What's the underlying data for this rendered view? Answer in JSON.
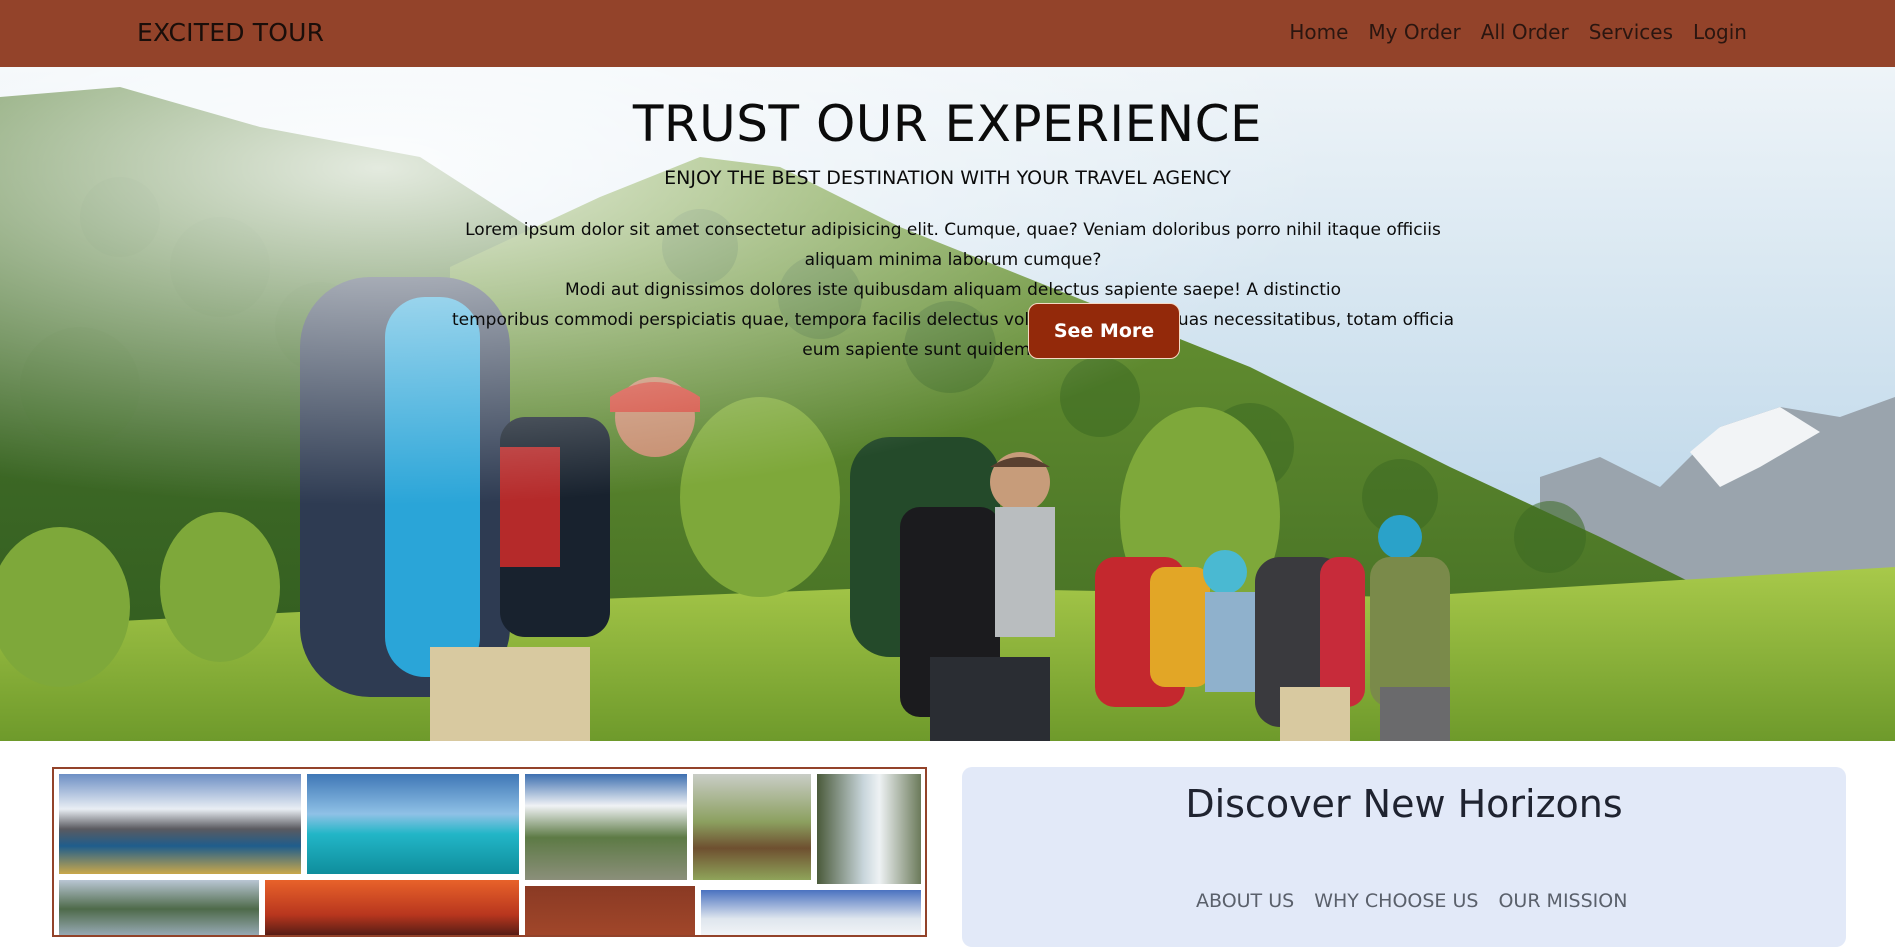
{
  "navbar": {
    "brand": "EXCITED TOUR",
    "links": [
      "Home",
      "My Order",
      "All Order",
      "Services",
      "Login"
    ],
    "background": "#93432a"
  },
  "hero": {
    "title": "TRUST OUR EXPERIENCE",
    "subtitle": "ENJOY THE BEST DESTINATION WITH YOUR TRAVEL AGENCY",
    "text_lines": [
      "Lorem ipsum dolor sit amet consectetur adipisicing elit. Cumque, quae? Veniam doloribus porro nihil itaque officiis aliquam minima laborum cumque?",
      "Modi aut dignissimos dolores iste quibusdam aliquam delectus sapiente saepe! A distinctio",
      "temporibus commodi perspiciatis quae, tempora facilis delectus voluptatem autem quas necessitatibus, totam officia eum sapiente sunt quidem dolores."
    ],
    "button_label": "See More",
    "button_color": "#93290a"
  },
  "discover": {
    "title": "Discover New Horizons",
    "tabs": [
      "ABOUT US",
      "WHY CHOOSE US",
      "OUR MISSION"
    ]
  }
}
